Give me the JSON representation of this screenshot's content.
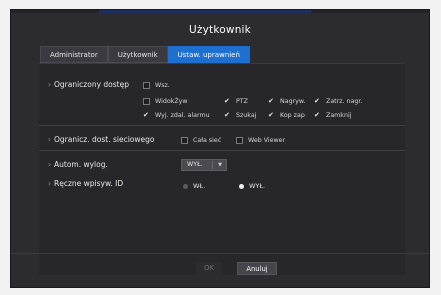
{
  "window": {
    "title": "Użytkownik"
  },
  "tabs": [
    {
      "label": "Administrator",
      "active": false
    },
    {
      "label": "Użytkownik",
      "active": false
    },
    {
      "label": "Ustaw. uprawnień",
      "active": true
    }
  ],
  "restricted_access": {
    "label": "Ograniczony dostęp",
    "all_label": "Wsz.",
    "options": [
      {
        "label": "WidokŻyw",
        "checked": false
      },
      {
        "label": "PTZ",
        "checked": true
      },
      {
        "label": "Nagryw.",
        "checked": true
      },
      {
        "label": "Zatrz. nagr.",
        "checked": true
      },
      {
        "label": "Wyj. zdal. alarmu",
        "checked": true
      },
      {
        "label": "Szukaj",
        "checked": true
      },
      {
        "label": "Kop zap",
        "checked": true
      },
      {
        "label": "Zamknij",
        "checked": true
      }
    ]
  },
  "network_restrict": {
    "label": "Ogranicz. dost. sieciowego",
    "options": [
      {
        "label": "Cała sieć",
        "checked": false
      },
      {
        "label": "Web Viewer",
        "checked": false
      }
    ]
  },
  "auto_logout": {
    "label": "Autom. wylog.",
    "value": "WYŁ."
  },
  "manual_id": {
    "label": "Ręczne wpisyw. ID",
    "options": [
      {
        "label": "WŁ.",
        "selected": false
      },
      {
        "label": "WYŁ.",
        "selected": true
      }
    ]
  },
  "footer": {
    "ok_label": "OK",
    "cancel_label": "Anuluj"
  },
  "colors": {
    "panel": "#2b2b30",
    "accent": "#1f6fd1",
    "text": "#e8e8e8"
  }
}
